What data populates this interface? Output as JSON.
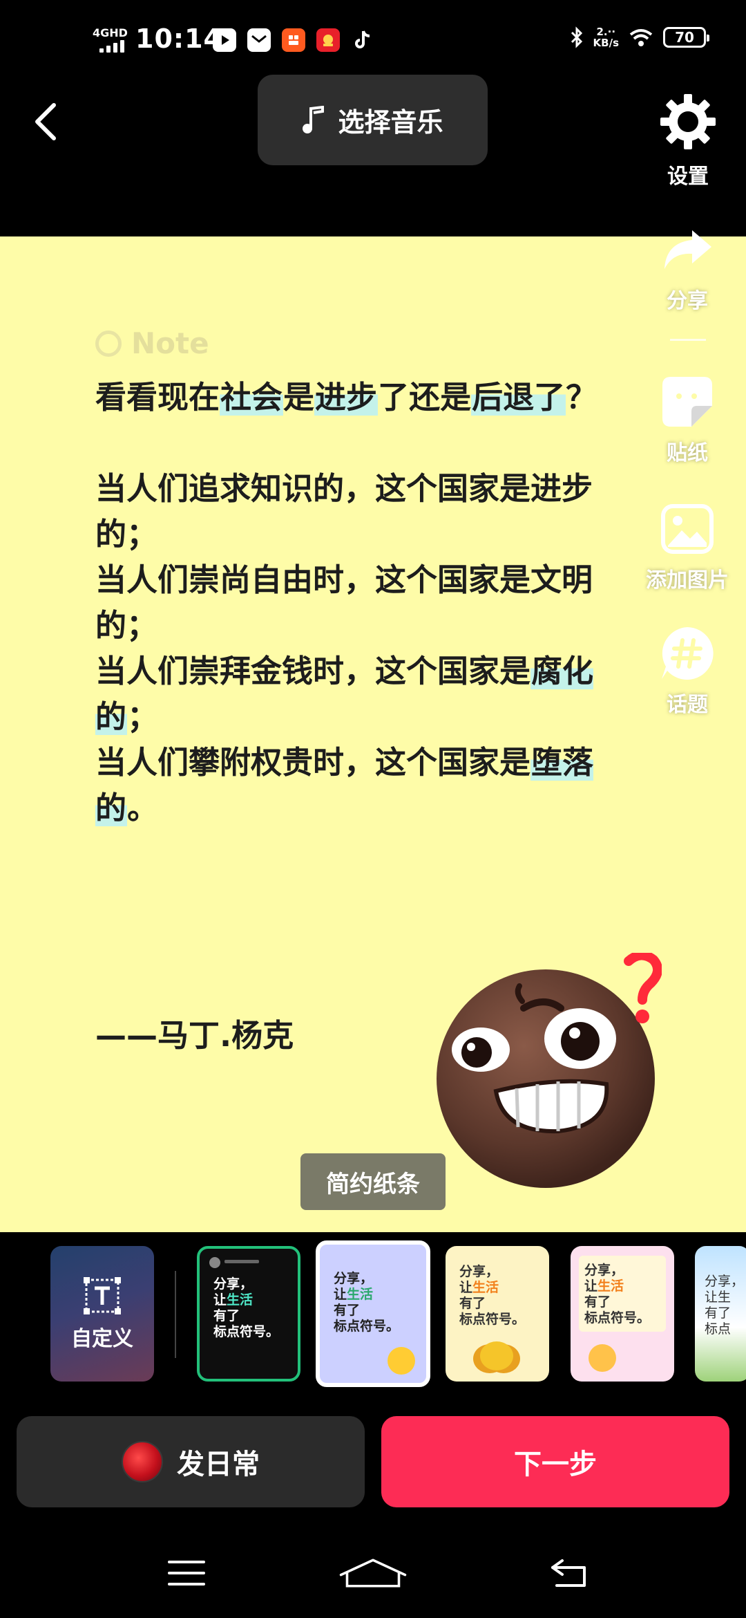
{
  "status_bar": {
    "network": "4GHD",
    "time": "10:14",
    "speed_value": "2.··",
    "speed_unit": "KB/s",
    "battery": "70",
    "apps": [
      "video-app-icon",
      "mail-app-icon",
      "orange-app-icon",
      "red-app-icon",
      "tiktok-icon"
    ]
  },
  "top_bar": {
    "music_label": "选择音乐",
    "settings_label": "设置"
  },
  "side_tools": {
    "share": "分享",
    "sticker": "贴纸",
    "add_image": "添加图片",
    "topic": "话题"
  },
  "note": {
    "header": "Note",
    "title_parts": [
      {
        "text": "看看现在",
        "hl": false
      },
      {
        "text": "社会",
        "hl": true
      },
      {
        "text": "是",
        "hl": false
      },
      {
        "text": "进步",
        "hl": true
      },
      {
        "text": "了还是",
        "hl": false
      },
      {
        "text": "后退了",
        "hl": true
      },
      {
        "text": "？",
        "hl": false
      }
    ],
    "line1": "当人们追求知识的，这个国家是进步的；",
    "line2": "当人们崇尚自由时，这个国家是文明的；",
    "line3_a": "当人们崇拜金钱时，这个国家是",
    "line3_hl": "腐化的",
    "line3_b": "；",
    "line4_a": "当人们攀附权贵时，这个国家是",
    "line4_hl": "堕落的",
    "line4_b": "。",
    "quote": "——马丁.杨克"
  },
  "template_tag": "简约纸条",
  "templates": {
    "custom_label": "自定义",
    "sample": {
      "l1": "分享，",
      "l2a": "让",
      "l2b": "生活",
      "l3": "有了",
      "l4": "标点符号。"
    },
    "last": {
      "l1": "分享，",
      "l2": "让生",
      "l3": "有了",
      "l4": "标点"
    }
  },
  "bottom": {
    "daily_label": "发日常",
    "next_label": "下一步"
  },
  "colors": {
    "canvas_bg": "#fefca8",
    "accent": "#fd2c55",
    "highlight": "#c4f2ea",
    "selected_template_border": "#22c07a"
  }
}
